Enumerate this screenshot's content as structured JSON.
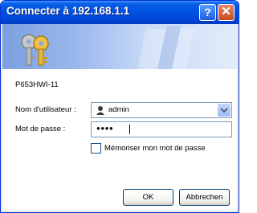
{
  "window": {
    "title": "Connecter à 192.168.1.1"
  },
  "titlebar": {
    "help_glyph": "?",
    "close_glyph": "✕"
  },
  "realm": "P653HWI-11",
  "username": {
    "label": "Nom d'utilisateur :",
    "value": "admin"
  },
  "password": {
    "label": "Mot de passe :",
    "masked_value": "●●●●"
  },
  "remember": {
    "label": "Mémoriser mon mot de passe",
    "checked": false
  },
  "buttons": {
    "ok": "OK",
    "cancel": "Abbrechen"
  },
  "icons": {
    "banner": "keys-icon",
    "user": "user-icon",
    "dropdown": "chevron-down-icon"
  },
  "colors": {
    "titlebar": "#0055e5",
    "dialog_bg": "#ece9d8",
    "input_border": "#7f9db9"
  }
}
